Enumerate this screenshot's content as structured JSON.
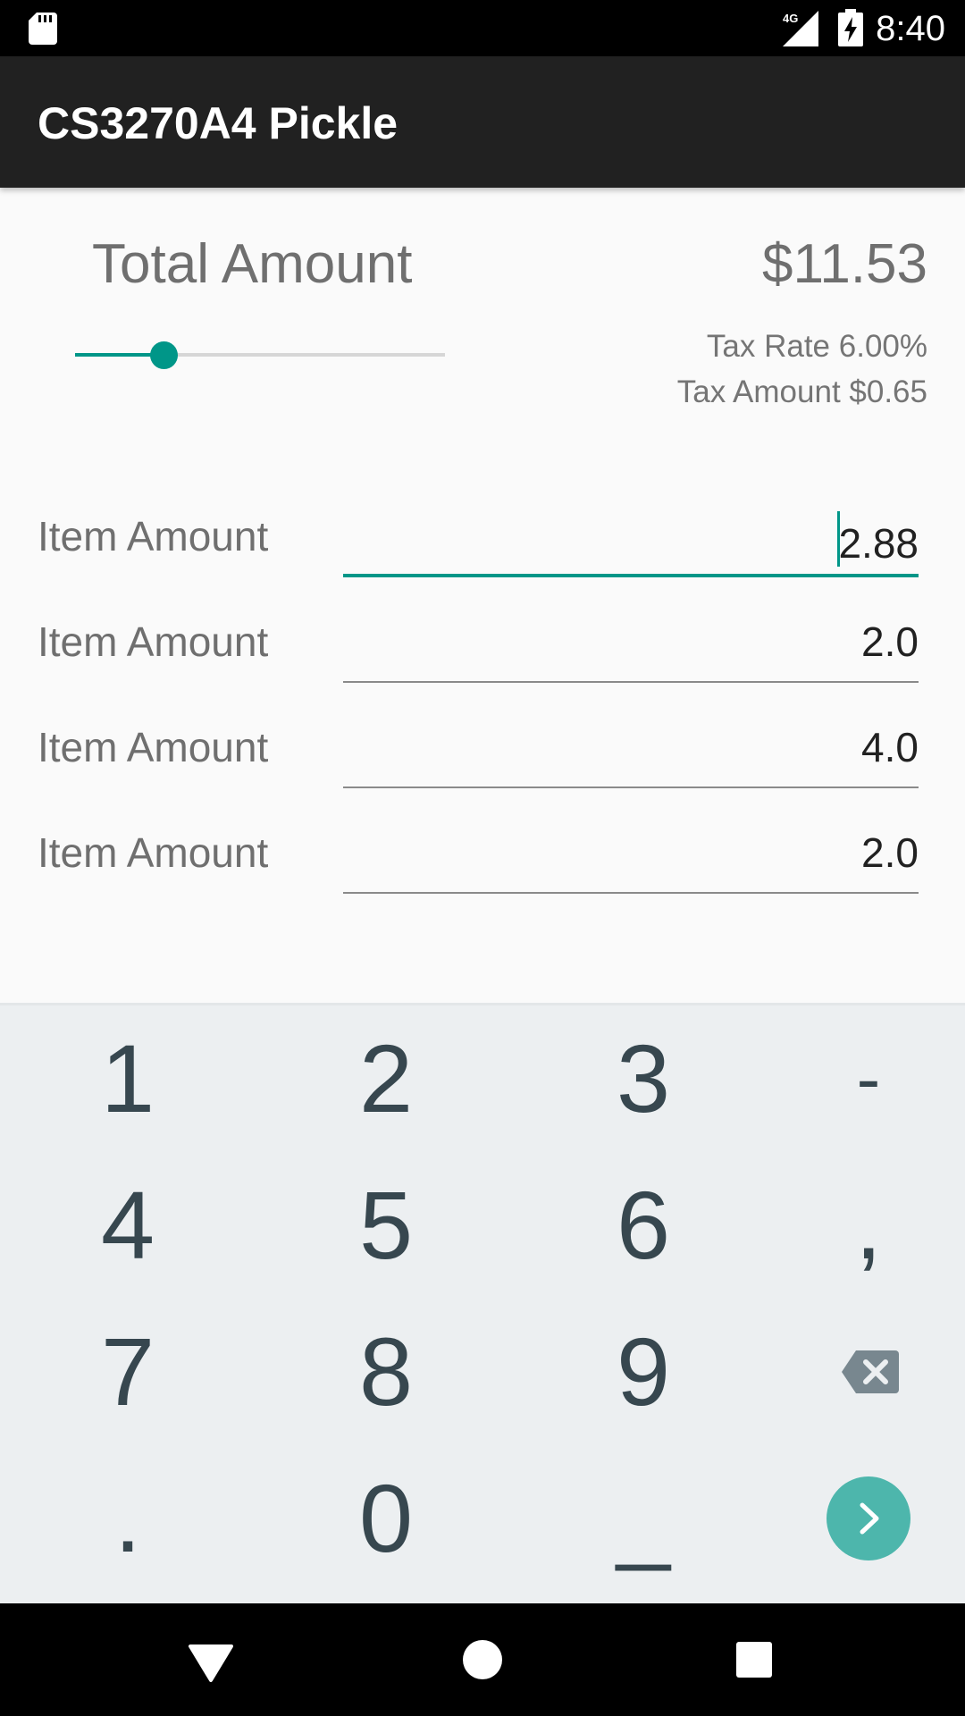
{
  "status_bar": {
    "time": "8:40",
    "network": "4G",
    "icons": [
      "sd-card-icon",
      "signal-icon",
      "battery-charging-icon"
    ]
  },
  "app_bar": {
    "title": "CS3270A4 Pickle"
  },
  "summary": {
    "total_label": "Total Amount",
    "total_value": "$11.53",
    "tax_rate_text": "Tax Rate 6.00%",
    "tax_amount_text": "Tax Amount $0.65",
    "slider_level": 0.24
  },
  "items": [
    {
      "label": "Item Amount",
      "value": "2.88",
      "focused": true
    },
    {
      "label": "Item Amount",
      "value": "2.0",
      "focused": false
    },
    {
      "label": "Item Amount",
      "value": "4.0",
      "focused": false
    },
    {
      "label": "Item Amount",
      "value": "2.0",
      "focused": false
    }
  ],
  "keyboard": {
    "rows": [
      [
        "1",
        "2",
        "3",
        "-"
      ],
      [
        "4",
        "5",
        "6",
        ","
      ],
      [
        "7",
        "8",
        "9",
        "backspace-icon"
      ],
      [
        ".",
        "0",
        "_",
        "go-icon"
      ]
    ],
    "accent_color": "#4db6ac"
  },
  "nav_bar": {
    "icons": [
      "back-icon",
      "home-icon",
      "recents-icon"
    ]
  },
  "colors": {
    "accent": "#009688",
    "app_bar": "#212121",
    "keyboard_bg": "#eceff1"
  }
}
